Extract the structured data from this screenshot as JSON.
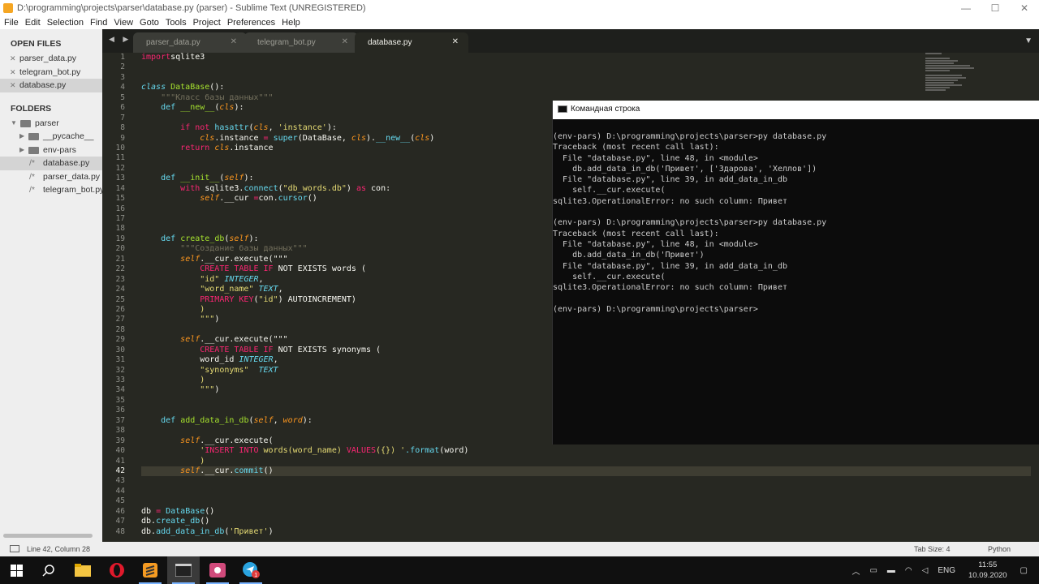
{
  "window": {
    "title": "D:\\programming\\projects\\parser\\database.py (parser) - Sublime Text (UNREGISTERED)",
    "controls": {
      "minimize": "—",
      "maximize": "☐",
      "close": "✕"
    }
  },
  "menu": [
    "File",
    "Edit",
    "Selection",
    "Find",
    "View",
    "Goto",
    "Tools",
    "Project",
    "Preferences",
    "Help"
  ],
  "sidebar": {
    "open_files_header": "OPEN FILES",
    "open_files": [
      "parser_data.py",
      "telegram_bot.py",
      "database.py"
    ],
    "folders_header": "FOLDERS",
    "root_folder": "parser",
    "subfolders": [
      "__pycache__",
      "env-pars"
    ],
    "files": [
      "database.py",
      "parser_data.py",
      "telegram_bot.py"
    ],
    "file_prefix": "/*"
  },
  "tabs": [
    {
      "label": "parser_data.py",
      "close": "✕"
    },
    {
      "label": "telegram_bot.py",
      "close": "✕"
    },
    {
      "label": "database.py",
      "close": "✕"
    }
  ],
  "tab_nav": "◀ ▶",
  "tab_menu": "▼",
  "editor": {
    "current_line": 42,
    "lines": [
      [
        [
          "kw",
          "import"
        ],
        [
          "",
          "sqlite3"
        ]
      ],
      [],
      [],
      [
        [
          "ty",
          "class "
        ],
        [
          "cls",
          "DataBase"
        ],
        [
          "",
          "():"
        ]
      ],
      [
        [
          "",
          "    "
        ],
        [
          "cm",
          "\"\"\"Класс базы данных\"\"\""
        ]
      ],
      [
        [
          "",
          "    "
        ],
        [
          "bi",
          "def "
        ],
        [
          "fn",
          "__new__"
        ],
        [
          "",
          "("
        ],
        [
          "pa",
          "cls"
        ],
        [
          "",
          "):"
        ]
      ],
      [],
      [
        [
          "",
          "        "
        ],
        [
          "kw",
          "if not "
        ],
        [
          "bi",
          "hasattr"
        ],
        [
          "",
          "("
        ],
        [
          "pa",
          "cls"
        ],
        [
          "",
          ", "
        ],
        [
          "st",
          "'instance'"
        ],
        [
          "",
          "):"
        ]
      ],
      [
        [
          "",
          "            "
        ],
        [
          "pa",
          "cls"
        ],
        [
          "",
          ".instance "
        ],
        [
          "kw",
          "="
        ],
        [
          "bi",
          " super"
        ],
        [
          "",
          "(DataBase, "
        ],
        [
          "pa",
          "cls"
        ],
        [
          "",
          ")."
        ],
        [
          "bi",
          "__new__"
        ],
        [
          "",
          "("
        ],
        [
          "pa",
          "cls"
        ],
        [
          "",
          ")"
        ]
      ],
      [
        [
          "",
          "        "
        ],
        [
          "kw",
          "return "
        ],
        [
          "pa",
          "cls"
        ],
        [
          "",
          ".instance"
        ]
      ],
      [],
      [],
      [
        [
          "",
          "    "
        ],
        [
          "bi",
          "def "
        ],
        [
          "fn",
          "__init__"
        ],
        [
          "",
          "("
        ],
        [
          "pa",
          "self"
        ],
        [
          "",
          "):"
        ]
      ],
      [
        [
          "",
          "        "
        ],
        [
          "kw",
          "with "
        ],
        [
          "",
          "sqlite3."
        ],
        [
          "bi",
          "connect"
        ],
        [
          "",
          "("
        ],
        [
          "st",
          "\"db_words.db\""
        ],
        [
          "",
          ") "
        ],
        [
          "kw",
          "as "
        ],
        [
          "",
          "con:"
        ]
      ],
      [
        [
          "",
          "            "
        ],
        [
          "pa",
          "self"
        ],
        [
          "",
          ".__cur "
        ],
        [
          "kw",
          "="
        ],
        [
          "",
          ""
        ],
        [
          "",
          "con."
        ],
        [
          "bi",
          "cursor"
        ],
        [
          "",
          "()"
        ]
      ],
      [],
      [],
      [],
      [
        [
          "",
          "    "
        ],
        [
          "bi",
          "def "
        ],
        [
          "fn",
          "create_db"
        ],
        [
          "",
          "("
        ],
        [
          "pa",
          "self"
        ],
        [
          "",
          "):"
        ]
      ],
      [
        [
          "",
          "        "
        ],
        [
          "cm",
          "\"\"\"Создание базы данных\"\"\""
        ]
      ],
      [
        [
          "",
          "        "
        ],
        [
          "pa",
          "self"
        ],
        [
          "",
          ".__cur.execute(\"\"\""
        ]
      ],
      [
        [
          "",
          "            "
        ],
        [
          "kw",
          "CREATE TABLE "
        ],
        [
          "kw",
          "IF "
        ],
        [
          "",
          "NOT EXISTS words ("
        ]
      ],
      [
        [
          "",
          "            "
        ],
        [
          "st",
          "\"id\" "
        ],
        [
          "ty",
          "INTEGER"
        ],
        [
          "",
          ","
        ]
      ],
      [
        [
          "",
          "            "
        ],
        [
          "st",
          "\"word_name\" "
        ],
        [
          "ty",
          "TEXT"
        ],
        [
          "",
          ","
        ]
      ],
      [
        [
          "",
          "            "
        ],
        [
          "kw",
          "PRIMARY KEY"
        ],
        [
          "",
          "("
        ],
        [
          "st",
          "\"id\""
        ],
        [
          "",
          ") AUTOINCREMENT)"
        ]
      ],
      [
        [
          "",
          "            "
        ],
        [
          "st",
          ")"
        ]
      ],
      [
        [
          "",
          "            "
        ],
        [
          "st",
          "\"\"\""
        ],
        [
          "",
          ")"
        ]
      ],
      [],
      [
        [
          "",
          "        "
        ],
        [
          "pa",
          "self"
        ],
        [
          "",
          ".__cur.execute(\"\"\""
        ]
      ],
      [
        [
          "",
          "            "
        ],
        [
          "kw",
          "CREATE TABLE "
        ],
        [
          "kw",
          "IF "
        ],
        [
          "",
          "NOT EXISTS synonyms ("
        ]
      ],
      [
        [
          "",
          "            "
        ],
        [
          "",
          "word_id "
        ],
        [
          "ty",
          "INTEGER"
        ],
        [
          "",
          ","
        ]
      ],
      [
        [
          "",
          "            "
        ],
        [
          "st",
          "\"synonyms\"  "
        ],
        [
          "ty",
          "TEXT"
        ]
      ],
      [
        [
          "",
          "            "
        ],
        [
          "st",
          ")"
        ]
      ],
      [
        [
          "",
          "            "
        ],
        [
          "st",
          "\"\"\""
        ],
        [
          "",
          ")"
        ]
      ],
      [],
      [],
      [
        [
          "",
          "    "
        ],
        [
          "bi",
          "def "
        ],
        [
          "fn",
          "add_data_in_db"
        ],
        [
          "",
          "("
        ],
        [
          "pa",
          "self"
        ],
        [
          "",
          ", "
        ],
        [
          "pa",
          "word"
        ],
        [
          "",
          "):"
        ]
      ],
      [],
      [
        [
          "",
          "        "
        ],
        [
          "pa",
          "self"
        ],
        [
          "",
          ".__cur.execute("
        ]
      ],
      [
        [
          "",
          "            "
        ],
        [
          "st",
          "'"
        ],
        [
          "kw",
          "INSERT INTO "
        ],
        [
          "st",
          "words(word_name) "
        ],
        [
          "kw",
          "VALUES"
        ],
        [
          "st",
          "({}) '"
        ],
        [
          "",
          ""
        ],
        [
          "bi",
          "."
        ],
        [
          "bi",
          "format"
        ],
        [
          "",
          "(word)"
        ]
      ],
      [
        [
          "",
          "            "
        ],
        [
          "st",
          ")"
        ]
      ],
      [
        [
          "",
          "        "
        ],
        [
          "pa",
          "self"
        ],
        [
          "",
          ".__cur."
        ],
        [
          "bi",
          "commit"
        ],
        [
          "",
          "()"
        ]
      ],
      [],
      [],
      [],
      [
        [
          "",
          "db "
        ],
        [
          "kw",
          "= "
        ],
        [
          "bi",
          "DataBase"
        ],
        [
          "",
          "()"
        ]
      ],
      [
        [
          "",
          "db."
        ],
        [
          "bi",
          "create_db"
        ],
        [
          "",
          "()"
        ]
      ],
      [
        [
          "",
          "db."
        ],
        [
          "bi",
          "add_data_in_db"
        ],
        [
          "",
          "("
        ],
        [
          "st",
          "'Привет'"
        ],
        [
          "",
          ")"
        ]
      ]
    ]
  },
  "console": {
    "title": "Командная строка",
    "lines": [
      "(env-pars) D:\\programming\\projects\\parser>py database.py",
      "Traceback (most recent call last):",
      "  File \"database.py\", line 48, in <module>",
      "    db.add_data_in_db('Привет', ['Здарова', 'Хеллов'])",
      "  File \"database.py\", line 39, in add_data_in_db",
      "    self.__cur.execute(",
      "sqlite3.OperationalError: no such column: Привет",
      "",
      "(env-pars) D:\\programming\\projects\\parser>py database.py",
      "Traceback (most recent call last):",
      "  File \"database.py\", line 48, in <module>",
      "    db.add_data_in_db('Привет')",
      "  File \"database.py\", line 39, in add_data_in_db",
      "    self.__cur.execute(",
      "sqlite3.OperationalError: no such column: Привет",
      "",
      "(env-pars) D:\\programming\\projects\\parser>"
    ]
  },
  "status": {
    "position": "Line 42, Column 28",
    "tab_size": "Tab Size: 4",
    "syntax": "Python"
  },
  "taskbar": {
    "lang": "ENG",
    "time": "11:55",
    "date": "10.09.2020",
    "telegram_badge": "1"
  },
  "colors": {
    "accent": "#f92672",
    "function": "#a6e22e",
    "builtin": "#66d9ef",
    "string": "#e6db74",
    "comment": "#75715e",
    "parameter": "#fd971f"
  }
}
